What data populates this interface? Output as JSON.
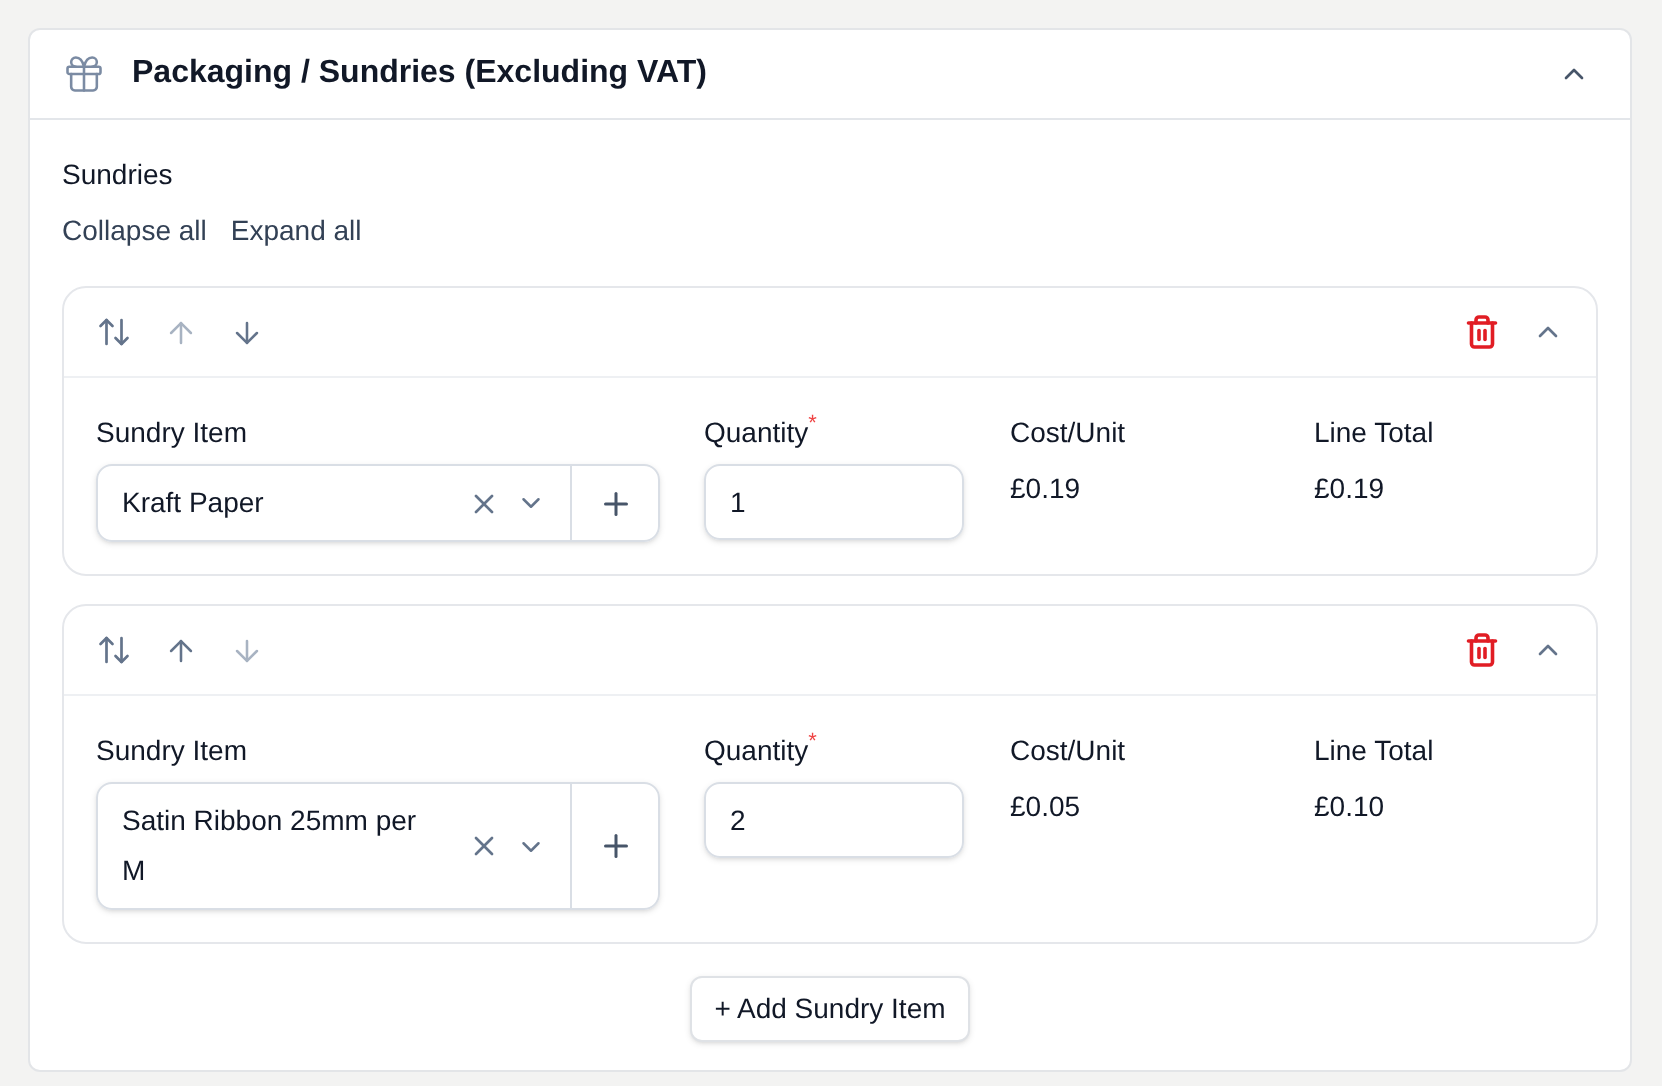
{
  "panel": {
    "title": "Packaging / Sundries (Excluding VAT)",
    "expanded": true
  },
  "section": {
    "label": "Sundries",
    "actions": [
      "Collapse all",
      "Expand all"
    ]
  },
  "items": [
    {
      "expanded": true,
      "can_move_up": false,
      "can_move_down": true,
      "item_label": "Sundry Item",
      "item_value": "Kraft Paper",
      "quantity_label": "Quantity",
      "required_mark": "*",
      "quantity": "1",
      "cost_label": "Cost/Unit",
      "cost": "£0.19",
      "total_label": "Line Total",
      "total": "£0.19"
    },
    {
      "expanded": true,
      "can_move_up": true,
      "can_move_down": false,
      "item_label": "Sundry Item",
      "item_value": "Satin Ribbon 25mm per M",
      "quantity_label": "Quantity",
      "required_mark": "*",
      "quantity": "2",
      "cost_label": "Cost/Unit",
      "cost": "£0.05",
      "total_label": "Line Total",
      "total": "£0.10"
    }
  ],
  "add_button": "+ Add Sundry Item"
}
